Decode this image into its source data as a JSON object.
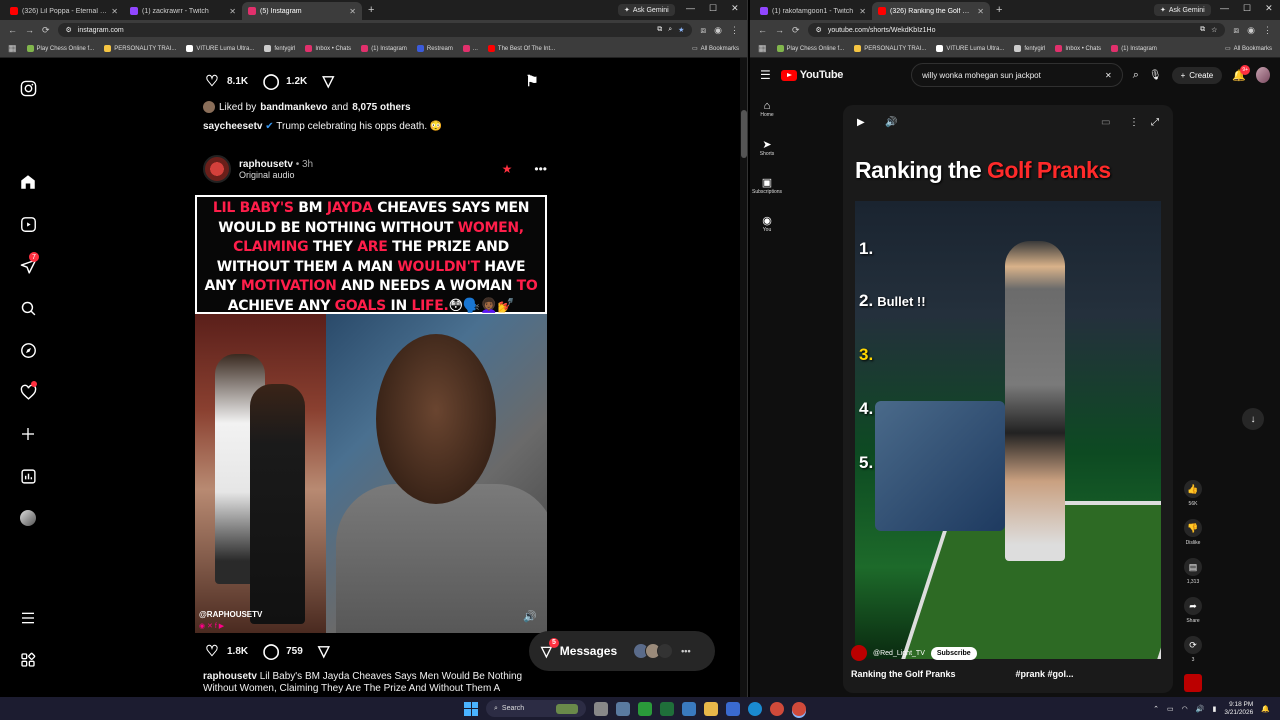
{
  "left_browser": {
    "tabs": [
      {
        "title": "(326) Lil Poppa - Eternal Living",
        "color": "#ff0000",
        "active": false
      },
      {
        "title": "(1) zackrawrr - Twitch",
        "color": "#9146ff",
        "active": false
      },
      {
        "title": "(5) Instagram",
        "color": "#e1306c",
        "active": true
      }
    ],
    "gemini": "Ask Gemini",
    "url": "instagram.com",
    "bookmarks": [
      {
        "label": "Play Chess Online f...",
        "color": "#81b64c"
      },
      {
        "label": "PERSONALITY TRAI...",
        "color": "#f5c542"
      },
      {
        "label": "VITURE Luma Ultra...",
        "color": "#ffffff"
      },
      {
        "label": "fentygirl",
        "color": "#cccccc"
      },
      {
        "label": "Inbox • Chats",
        "color": "#e1306c"
      },
      {
        "label": "(1) Instagram",
        "color": "#e1306c"
      },
      {
        "label": "Restream",
        "color": "#3b5bdb"
      },
      {
        "label": "...",
        "color": "#e1306c"
      },
      {
        "label": "The Best Of The Int...",
        "color": "#ff0000"
      }
    ],
    "all_bookmarks": "All Bookmarks"
  },
  "instagram": {
    "rail": {
      "notifications_badge": "7",
      "icons": [
        "instagram-logo-icon",
        "home-icon",
        "reels-icon",
        "direct-icon",
        "search-icon",
        "explore-icon",
        "heart-icon",
        "create-icon",
        "dashboard-icon",
        "profile-icon",
        "more-menu-icon",
        "also-from-meta-icon"
      ]
    },
    "prev_post": {
      "likes": "8.1K",
      "comments": "1.2K",
      "liked_by_prefix": "Liked by",
      "liked_by_user": "bandmankevo",
      "liked_by_and": "and",
      "liked_by_others": "8,075 others",
      "caption_user": "saycheesetv",
      "caption_text": "Trump celebrating his opps death. 😳"
    },
    "post": {
      "username": "raphousetv",
      "time": "• 3h",
      "audio": "Original audio",
      "headline_parts": [
        {
          "t": "LIL BABY'S",
          "hl": true
        },
        {
          "t": " BM ",
          "hl": false
        },
        {
          "t": "JAYDA",
          "hl": true
        },
        {
          "t": " CHEAVES SAYS MEN WOULD BE NOTHING WITHOUT ",
          "hl": false
        },
        {
          "t": "WOMEN,",
          "hl": true
        },
        {
          "t": " ",
          "hl": false
        },
        {
          "t": "CLAIMING",
          "hl": true
        },
        {
          "t": " THEY ",
          "hl": false
        },
        {
          "t": "ARE",
          "hl": true
        },
        {
          "t": " THE PRIZE AND WITHOUT THEM A MAN ",
          "hl": false
        },
        {
          "t": "WOULDN'T",
          "hl": true
        },
        {
          "t": " HAVE ANY ",
          "hl": false
        },
        {
          "t": "MOTIVATION",
          "hl": true
        },
        {
          "t": " AND NEEDS A WOMAN ",
          "hl": false
        },
        {
          "t": "TO",
          "hl": true
        },
        {
          "t": " ACHIEVE ANY ",
          "hl": false
        },
        {
          "t": "GOALS",
          "hl": true
        },
        {
          "t": " IN ",
          "hl": false
        },
        {
          "t": "LIFE.",
          "hl": true
        },
        {
          "t": "😳🗣️👩🏾‍🦱💅",
          "hl": false
        }
      ],
      "watermark": "@RAPHOUSETV",
      "likes": "1.8K",
      "comments": "759",
      "caption_user": "raphousetv",
      "caption_text": "Lil Baby's BM Jayda Cheaves Says Men Would Be Nothing Without Women, Claiming They Are The Prize And Without Them A"
    },
    "messages": {
      "label": "Messages",
      "badge": "5"
    }
  },
  "right_browser": {
    "tabs": [
      {
        "title": "(1) rakofamgoon1 - Twitch",
        "color": "#9146ff",
        "active": false
      },
      {
        "title": "(326) Ranking the Golf Pranks",
        "color": "#ff0000",
        "active": true
      }
    ],
    "gemini": "Ask Gemini",
    "url": "youtube.com/shorts/WekdKbIz1Ho",
    "bookmarks": [
      {
        "label": "Play Chess Online f...",
        "color": "#81b64c"
      },
      {
        "label": "PERSONALITY TRAI...",
        "color": "#f5c542"
      },
      {
        "label": "VITURE Luma Ultra...",
        "color": "#ffffff"
      },
      {
        "label": "fentygirl",
        "color": "#cccccc"
      },
      {
        "label": "Inbox • Chats",
        "color": "#e1306c"
      },
      {
        "label": "(1) Instagram",
        "color": "#e1306c"
      }
    ],
    "all_bookmarks": "All Bookmarks"
  },
  "youtube": {
    "logo": "YouTube",
    "search_query": "willy wonka mohegan sun jackpot",
    "create": "Create",
    "notif_badge": "9+",
    "rail": [
      {
        "icon": "home-icon",
        "glyph": "⌂",
        "label": "Home"
      },
      {
        "icon": "shorts-icon",
        "glyph": "➤",
        "label": "Shorts"
      },
      {
        "icon": "subscriptions-icon",
        "glyph": "▣",
        "label": "Subscriptions"
      },
      {
        "icon": "you-icon",
        "glyph": "◉",
        "label": "You"
      }
    ],
    "short": {
      "title_a": "Ranking the ",
      "title_b": "Golf Pranks",
      "ranks": [
        "1.",
        "2.",
        "3.",
        "4.",
        "5."
      ],
      "rank2_label": "Bullet !!",
      "channel": "@Red_Light_TV",
      "subscribe": "Subscribe",
      "video_title": "Ranking the Golf Pranks",
      "hashtags": "#prank #gol..."
    },
    "side_actions": [
      {
        "icon": "like-icon",
        "glyph": "👍",
        "label": "56K"
      },
      {
        "icon": "dislike-icon",
        "glyph": "👎",
        "label": "Dislike"
      },
      {
        "icon": "comments-icon",
        "glyph": "▤",
        "label": "1,313"
      },
      {
        "icon": "share-icon",
        "glyph": "➦",
        "label": "Share"
      },
      {
        "icon": "remix-icon",
        "glyph": "⟳",
        "label": "3"
      }
    ]
  },
  "taskbar": {
    "search": "Search",
    "time": "9:18 PM",
    "date": "3/21/2026"
  }
}
